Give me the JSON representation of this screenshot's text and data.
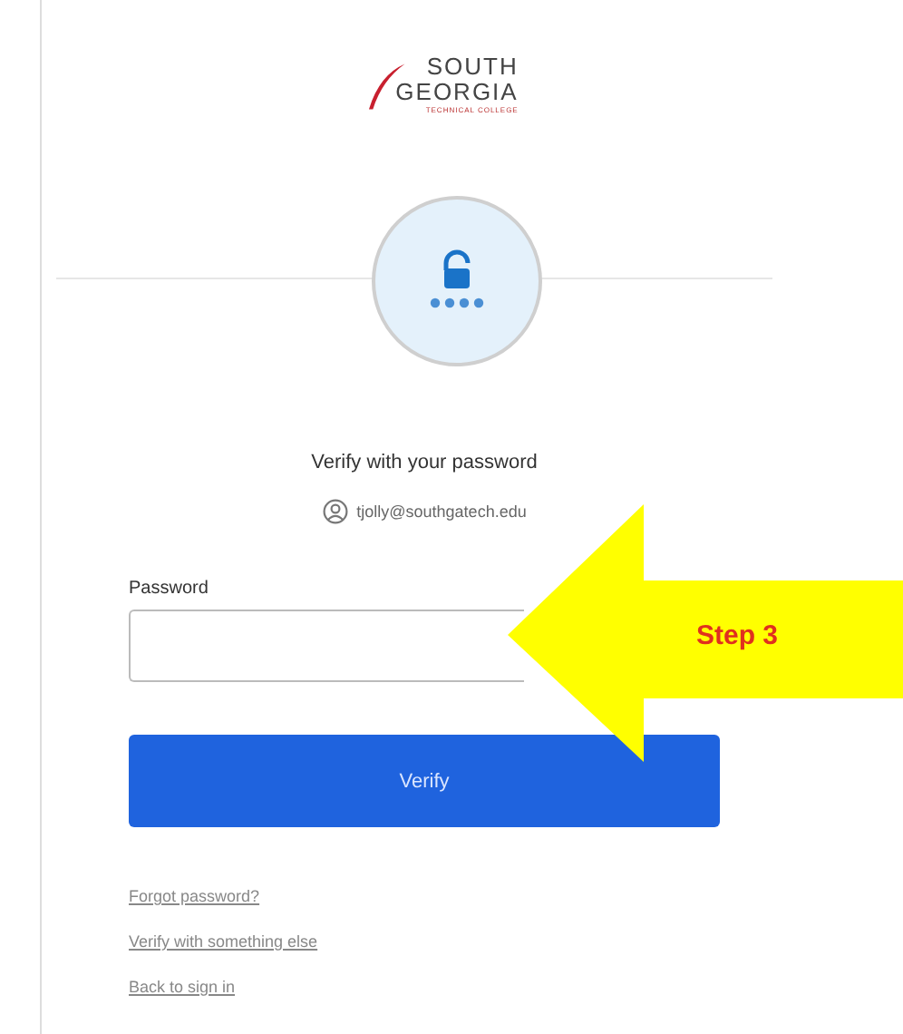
{
  "logo": {
    "lines": [
      "SOUTH",
      "GEORGIA"
    ],
    "tagline": "TECHNICAL COLLEGE"
  },
  "heading": "Verify with your password",
  "account": "tjolly@southgatech.edu",
  "password_field": {
    "label": "Password"
  },
  "button": "Verify",
  "links": [
    "Forgot password?",
    "Verify with something else",
    "Back to sign in"
  ],
  "annotation": {
    "text": "Step 3"
  }
}
